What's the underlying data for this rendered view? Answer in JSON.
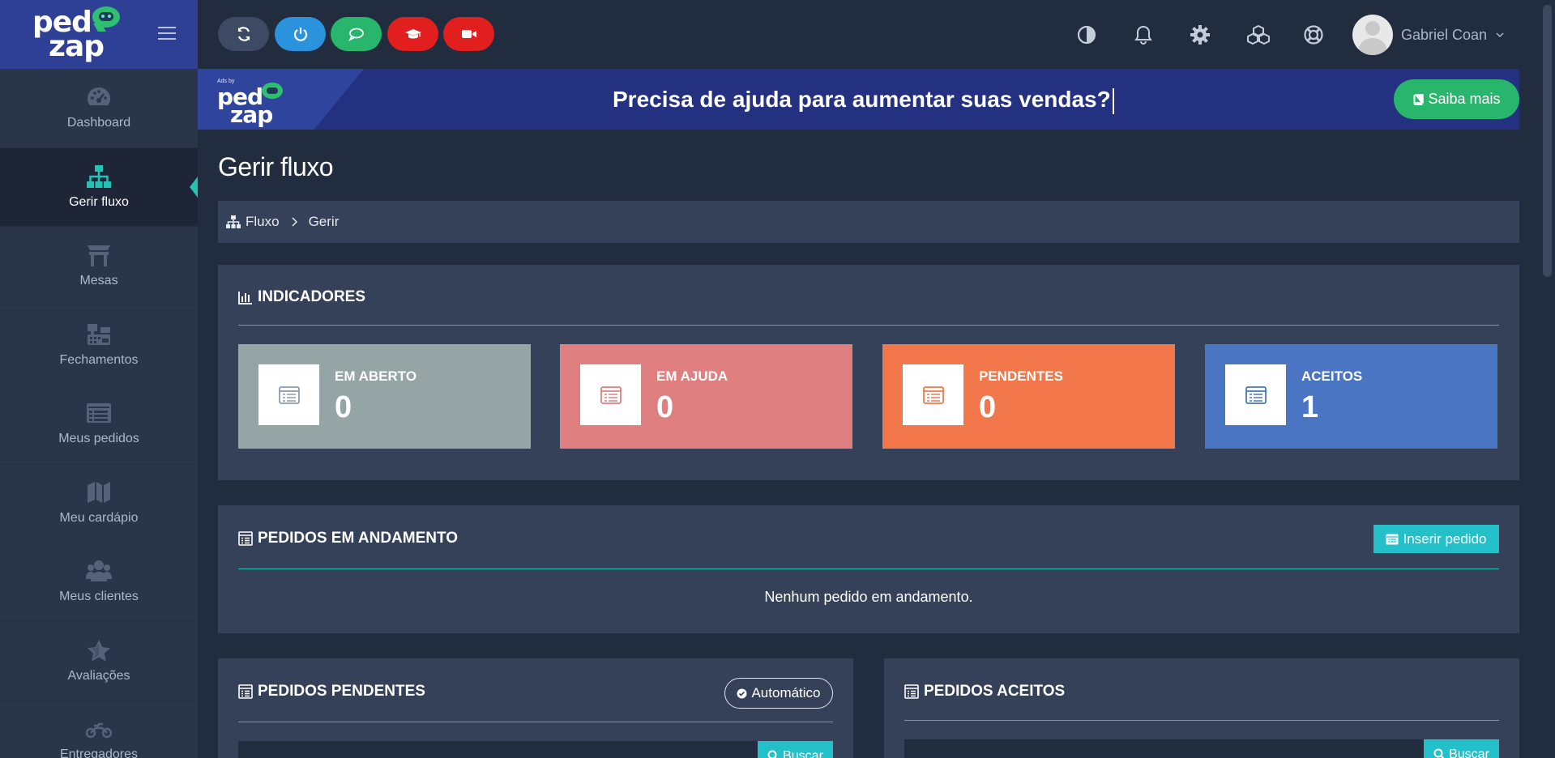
{
  "app": {
    "logo_line1": "ped",
    "logo_line2": "zap"
  },
  "topbar": {
    "quick_buttons": [
      {
        "icon": "refresh-icon",
        "color": "#3c4a63"
      },
      {
        "icon": "power-icon",
        "color": "#2b93de"
      },
      {
        "icon": "chat-bubble-icon",
        "color": "#27b66c"
      },
      {
        "icon": "graduation-cap-icon",
        "color": "#e21f1f"
      },
      {
        "icon": "video-camera-icon",
        "color": "#e21f1f"
      }
    ],
    "icons": [
      "contrast-icon",
      "bell-icon",
      "gear-icon",
      "cubes-icon",
      "lifebuoy-icon"
    ],
    "user_name": "Gabriel Coan"
  },
  "ad": {
    "ads_by": "Ads by",
    "logo_line1": "ped",
    "logo_line2": "zap",
    "title": "Precisa de ajuda para aumentar suas vendas?",
    "button_label": "Saiba mais"
  },
  "sidebar": {
    "items": [
      {
        "label": "Dashboard",
        "icon": "dashboard-icon"
      },
      {
        "label": "Gerir fluxo",
        "icon": "sitemap-icon",
        "active": true
      },
      {
        "label": "Mesas",
        "icon": "table-icon"
      },
      {
        "label": "Fechamentos",
        "icon": "cash-register-icon"
      },
      {
        "label": "Meus pedidos",
        "icon": "list-alt-icon"
      },
      {
        "label": "Meu cardápio",
        "icon": "map-icon"
      },
      {
        "label": "Meus clientes",
        "icon": "users-icon"
      },
      {
        "label": "Avaliações",
        "icon": "star-icon"
      },
      {
        "label": "Entregadores",
        "icon": "motorcycle-icon"
      }
    ]
  },
  "page": {
    "title": "Gerir fluxo"
  },
  "breadcrumb": {
    "items": [
      "Fluxo",
      "Gerir"
    ]
  },
  "indicators": {
    "title": "INDICADORES",
    "cards": [
      {
        "label": "EM ABERTO",
        "value": "0",
        "color": "#95a5a6",
        "icon_color": "#8d9aa9"
      },
      {
        "label": "EM AJUDA",
        "value": "0",
        "color": "#e07f80",
        "icon_color": "#e07f80"
      },
      {
        "label": "PENDENTES",
        "value": "0",
        "color": "#f2784b",
        "icon_color": "#f2784b"
      },
      {
        "label": "ACEITOS",
        "value": "1",
        "color": "#4a75c2",
        "icon_color": "#4a75c2"
      }
    ]
  },
  "orders_in_progress": {
    "title": "PEDIDOS EM ANDAMENTO",
    "insert_button": "Inserir pedido",
    "empty_message": "Nenhum pedido em andamento."
  },
  "pending_orders": {
    "title": "PEDIDOS PENDENTES",
    "auto_button": "Automático",
    "search_button": "Buscar"
  },
  "accepted_orders": {
    "title": "PEDIDOS ACEITOS",
    "search_button": "Buscar"
  },
  "colors": {
    "accent": "#24c2b3",
    "sidebar_bg": "#2b3549",
    "panel_bg": "#354159",
    "page_bg": "#222c3f"
  }
}
